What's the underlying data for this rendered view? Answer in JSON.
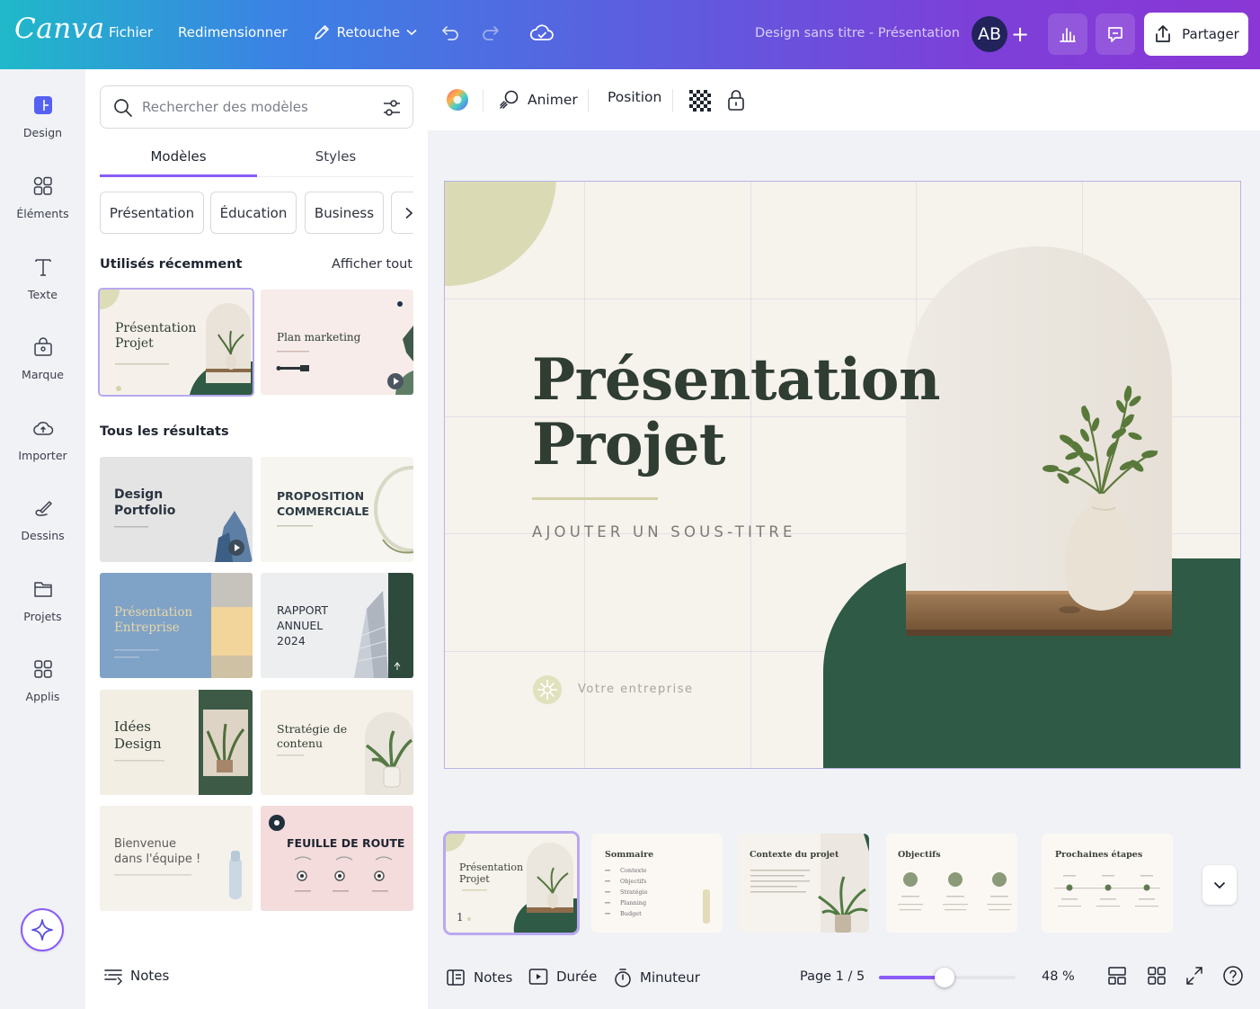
{
  "app": {
    "logo": "Canva",
    "doc_title": "Design sans titre - Présentation"
  },
  "topbar": {
    "menu": [
      "Fichier",
      "Redimensionner"
    ],
    "retouche": "Retouche",
    "avatar_initials": "AB",
    "plus": "+",
    "share_label": "Partager"
  },
  "rail": [
    {
      "label": "Design",
      "icon": "design-icon"
    },
    {
      "label": "Éléments",
      "icon": "elements-icon"
    },
    {
      "label": "Texte",
      "icon": "text-icon"
    },
    {
      "label": "Marque",
      "icon": "brand-icon"
    },
    {
      "label": "Importer",
      "icon": "upload-icon"
    },
    {
      "label": "Dessins",
      "icon": "draw-icon"
    },
    {
      "label": "Projets",
      "icon": "folder-icon"
    },
    {
      "label": "Applis",
      "icon": "apps-icon"
    }
  ],
  "panel": {
    "search_placeholder": "Rechercher des modèles",
    "tabs": [
      "Modèles",
      "Styles"
    ],
    "chips": [
      "Présentation",
      "Éducation",
      "Business"
    ],
    "recent_heading": "Utilisés récemment",
    "see_all": "Afficher tout",
    "recent": [
      {
        "title_1": "Présentation",
        "title_2": "Projet"
      },
      {
        "title_1": "Plan marketing"
      }
    ],
    "results_heading": "Tous les résultats",
    "results": [
      {
        "title_1": "Design",
        "title_2": "Portfolio"
      },
      {
        "title_1": "PROPOSITION",
        "title_2": "COMMERCIALE"
      },
      {
        "title_1": "Présentation",
        "title_2": "Entreprise"
      },
      {
        "title_1": "RAPPORT",
        "title_2": "ANNUEL",
        "title_3": "2024"
      },
      {
        "title_1": "Idées",
        "title_2": "Design"
      },
      {
        "title_1": "Stratégie de",
        "title_2": "contenu"
      },
      {
        "title_1": "Bienvenue",
        "title_2": "dans l'équipe !"
      },
      {
        "title_1": "FEUILLE DE ROUTE"
      }
    ],
    "notes_label": "Notes"
  },
  "canvas_toolbar": {
    "animate": "Animer",
    "position": "Position"
  },
  "slide": {
    "title_1": "Présentation",
    "title_2": "Projet",
    "subtitle": "AJOUTER UN SOUS-TITRE",
    "company": "Votre entreprise",
    "colors": {
      "dark_green": "#2f5a45",
      "sage": "#d8d8b2",
      "cream": "#f6f2ec",
      "arch": "#ece7df"
    }
  },
  "filmstrip": [
    {
      "title": "Présentation Projet",
      "title_1": "Présentation",
      "title_2": "Projet",
      "page_number": "1"
    },
    {
      "title": "Sommaire",
      "items": [
        "Contexte",
        "Objectifs",
        "Stratégie",
        "Planning",
        "Budget"
      ]
    },
    {
      "title": "Contexte du projet"
    },
    {
      "title": "Objectifs"
    },
    {
      "title": "Prochaines étapes"
    }
  ],
  "footer": {
    "notes": "Notes",
    "duration": "Durée",
    "timer": "Minuteur",
    "page_indicator": "Page 1 / 5",
    "zoom": "48 %",
    "zoom_fraction": 0.48
  }
}
